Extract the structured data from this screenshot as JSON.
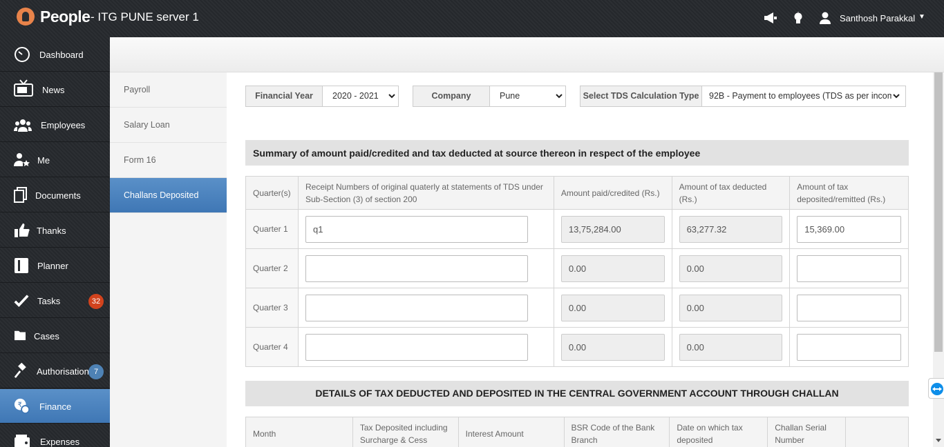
{
  "app": {
    "brand": "People",
    "server": "- ITG PUNE server 1",
    "user_name": "Santhosh Parakkal",
    "icons": [
      "megaphone-icon",
      "lightbulb-icon",
      "user-icon",
      "caret-down-icon"
    ]
  },
  "sidebar": {
    "items": [
      {
        "label": "Dashboard",
        "icon": "speedometer-icon"
      },
      {
        "label": "News",
        "icon": "tv-icon"
      },
      {
        "label": "Employees",
        "icon": "people-icon"
      },
      {
        "label": "Me",
        "icon": "person-star-icon"
      },
      {
        "label": "Documents",
        "icon": "documents-icon"
      },
      {
        "label": "Thanks",
        "icon": "thumbs-up-icon"
      },
      {
        "label": "Planner",
        "icon": "planner-icon"
      },
      {
        "label": "Tasks",
        "icon": "checkmark-icon",
        "badge": "32"
      },
      {
        "label": "Cases",
        "icon": "folder-icon"
      },
      {
        "label": "Authorisations",
        "icon": "gavel-icon",
        "badge": "7"
      },
      {
        "label": "Finance",
        "icon": "finance-icon",
        "active": true
      },
      {
        "label": "Expenses",
        "icon": "wallet-icon"
      }
    ]
  },
  "subnav": {
    "items": [
      "Payroll",
      "Salary Loan",
      "Form 16",
      "Challans Deposited"
    ],
    "active": "Challans Deposited"
  },
  "filters": {
    "financial_year": {
      "label": "Financial Year",
      "value": "2020 - 2021"
    },
    "company": {
      "label": "Company",
      "value": "Pune"
    },
    "tds_type": {
      "label": "Select TDS Calculation Type",
      "value": "92B - Payment to employees (TDS as per incom"
    }
  },
  "summary": {
    "title": "Summary of amount paid/credited and tax deducted at source thereon in respect of the employee",
    "headers": [
      "Quarter(s)",
      "Receipt Numbers of original quaterly at statements of TDS under Sub-Section (3) of section 200",
      "Amount paid/credited (Rs.)",
      "Amount of tax deducted (Rs.)",
      "Amount of tax deposited/remitted (Rs.)"
    ],
    "rows": [
      {
        "quarter": "Quarter 1",
        "receipt": "q1",
        "paid": "13,75,284.00",
        "deducted": "63,277.32",
        "deposited": "15,369.00"
      },
      {
        "quarter": "Quarter 2",
        "receipt": "",
        "paid": "0.00",
        "deducted": "0.00",
        "deposited": ""
      },
      {
        "quarter": "Quarter 3",
        "receipt": "",
        "paid": "0.00",
        "deducted": "0.00",
        "deposited": ""
      },
      {
        "quarter": "Quarter 4",
        "receipt": "",
        "paid": "0.00",
        "deducted": "0.00",
        "deposited": ""
      }
    ]
  },
  "challan": {
    "title": "DETAILS OF TAX DEDUCTED AND DEPOSITED IN THE CENTRAL GOVERNMENT ACCOUNT THROUGH CHALLAN",
    "headers": [
      "Month",
      "Tax Deposited including Surcharge & Cess",
      "Interest Amount",
      "BSR Code of the Bank Branch",
      "Date on which tax deposited",
      "Challan Serial Number",
      ""
    ]
  }
}
